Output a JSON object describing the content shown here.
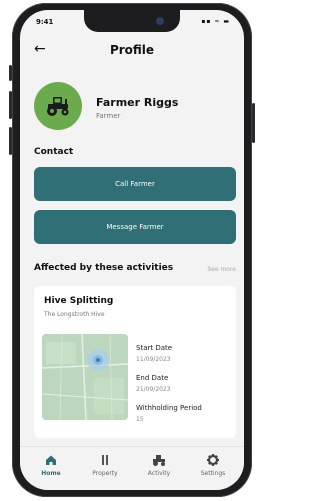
{
  "status_bar": {
    "time": "9:41",
    "icons": "▪▪ ≈ ▬"
  },
  "header": {
    "title": "Profile"
  },
  "profile": {
    "name": "Farmer Riggs",
    "role": "Farmer"
  },
  "contact": {
    "section_label": "Contact",
    "call_label": "Call Farmer",
    "message_label": "Message Farmer"
  },
  "activities": {
    "section_label": "Affected by these activities",
    "see_more_label": "See more",
    "card": {
      "title": "Hive Splitting",
      "subtitle": "The Longstroth Hive",
      "start_date_label": "Start Date",
      "start_date_value": "11/09/2023",
      "end_date_label": "End Date",
      "end_date_value": "21/09/2023",
      "withholding_label": "Withholding Period",
      "withholding_value": "15"
    }
  },
  "bottom_nav": {
    "items": [
      {
        "label": "Home",
        "icon": "home-icon",
        "active": true
      },
      {
        "label": "Property",
        "icon": "property-icon",
        "active": false
      },
      {
        "label": "Activity",
        "icon": "activity-icon",
        "active": false
      },
      {
        "label": "Settings",
        "icon": "settings-icon",
        "active": false
      }
    ]
  },
  "colors": {
    "accent": "#2f6f75",
    "avatar_green": "#6cab4d",
    "background": "#f3f3f3"
  }
}
